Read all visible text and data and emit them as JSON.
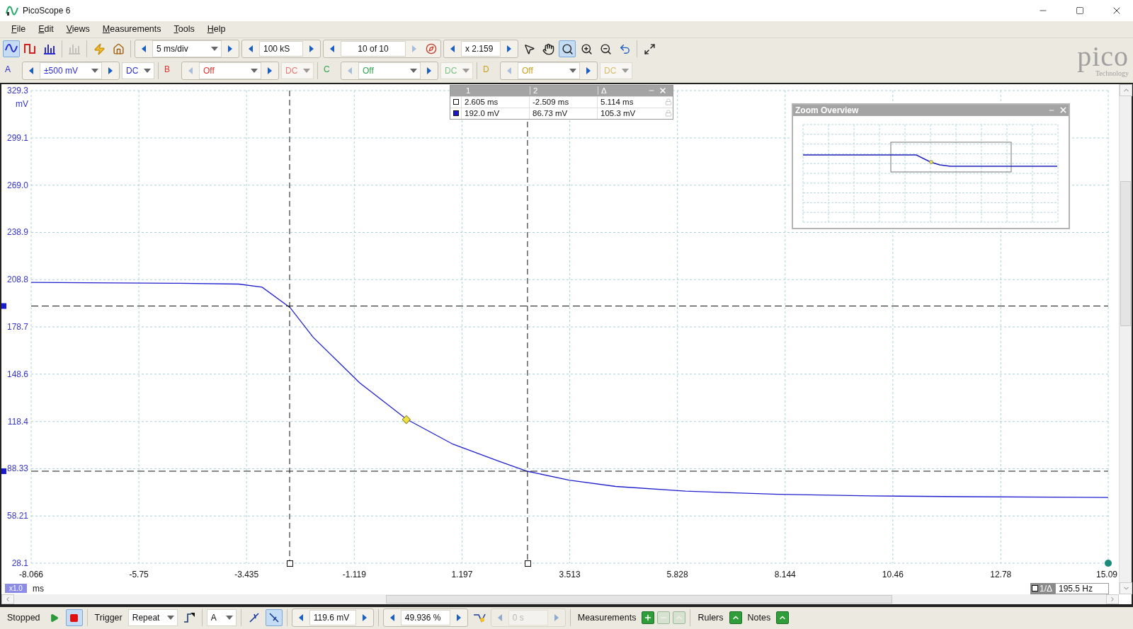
{
  "window": {
    "title": "PicoScope 6"
  },
  "menu": [
    "File",
    "Edit",
    "Views",
    "Measurements",
    "Tools",
    "Help"
  ],
  "toolbar": {
    "modes": [
      {
        "kind": "scope",
        "selected": true,
        "disabled": false
      },
      {
        "kind": "persistence",
        "selected": false,
        "disabled": false
      },
      {
        "kind": "spectrum",
        "selected": false,
        "disabled": false
      },
      {
        "kind": "xy",
        "selected": false,
        "disabled": true
      }
    ],
    "timebase": "5 ms/div",
    "samples": "100 kS",
    "buffer": "10 of 10",
    "zoom": "x 2.159",
    "tools": [
      {
        "kind": "pointer",
        "selected": false
      },
      {
        "kind": "hand",
        "selected": false
      },
      {
        "kind": "zoom-area",
        "selected": true
      },
      {
        "kind": "zoom-in",
        "selected": false
      },
      {
        "kind": "zoom-out",
        "selected": false
      },
      {
        "kind": "undo",
        "selected": false
      },
      {
        "kind": "zoom-fit",
        "selected": false
      }
    ]
  },
  "logo": {
    "name": "pico",
    "tagline": "Technology"
  },
  "channels": [
    {
      "label": "A",
      "color": "#2b2bd6",
      "range": "±500 mV",
      "coupling": "DC",
      "enabled": true
    },
    {
      "label": "B",
      "color": "#e03030",
      "range": "Off",
      "coupling": "DC",
      "enabled": false
    },
    {
      "label": "C",
      "color": "#2ea84a",
      "range": "Off",
      "coupling": "DC",
      "enabled": false
    },
    {
      "label": "D",
      "color": "#c8a020",
      "range": "Off",
      "coupling": "DC",
      "enabled": false
    }
  ],
  "rulers_table": {
    "columns": [
      "1",
      "2",
      "Δ"
    ],
    "rows": [
      {
        "kind": "time",
        "values": [
          "2.605 ms",
          "-2.509 ms",
          "5.114 ms"
        ]
      },
      {
        "kind": "signal",
        "values": [
          "192.0 mV",
          "86.73 mV",
          "105.3 mV"
        ]
      }
    ]
  },
  "zoom_overview": {
    "title": "Zoom Overview"
  },
  "scope": {
    "x_scale": "x1.0",
    "frequency_label": "1/Δ",
    "frequency": "195.5 Hz",
    "chart_data": {
      "type": "line",
      "xlabel": "ms",
      "ylabel": "mV",
      "xlim": [
        -8.066,
        15.09
      ],
      "ylim": [
        28.1,
        329.3
      ],
      "xticks": [
        {
          "value": -8.066,
          "label": "-8.066"
        },
        {
          "value": -5.75,
          "label": "-5.75"
        },
        {
          "value": -3.435,
          "label": "-3.435"
        },
        {
          "value": -1.119,
          "label": "-1.119"
        },
        {
          "value": 1.197,
          "label": "1.197"
        },
        {
          "value": 3.513,
          "label": "3.513"
        },
        {
          "value": 5.828,
          "label": "5.828"
        },
        {
          "value": 8.144,
          "label": "8.144"
        },
        {
          "value": 10.46,
          "label": "10.46"
        },
        {
          "value": 12.78,
          "label": "12.78"
        },
        {
          "value": 15.09,
          "label": "15.09"
        }
      ],
      "yticks": [
        {
          "value": 329.3,
          "label": "329.3"
        },
        {
          "value": 299.1,
          "label": "299.1"
        },
        {
          "value": 269.0,
          "label": "269.0"
        },
        {
          "value": 238.9,
          "label": "238.9"
        },
        {
          "value": 208.8,
          "label": "208.8"
        },
        {
          "value": 178.7,
          "label": "178.7"
        },
        {
          "value": 148.6,
          "label": "148.6"
        },
        {
          "value": 118.4,
          "label": "118.4"
        },
        {
          "value": 88.33,
          "label": "88.33"
        },
        {
          "value": 58.21,
          "label": "58.21"
        },
        {
          "value": 28.1,
          "label": "28.1"
        }
      ],
      "x": [
        -8.066,
        -5,
        -3.6,
        -3.1,
        -2.5,
        -2,
        -1,
        0,
        1,
        2,
        2.6,
        3.5,
        4.5,
        6,
        8,
        10,
        12,
        15.09
      ],
      "series": [
        {
          "color": "#2020d0",
          "values": [
            207,
            206.5,
            206,
            204,
            191,
            172,
            143,
            120,
            104,
            93,
            86.7,
            81,
            77,
            74,
            72,
            71,
            70.5,
            70
          ]
        }
      ],
      "grid": true,
      "ref_lines": [
        {
          "axis": "x",
          "value": -2.509
        },
        {
          "axis": "x",
          "value": 2.605
        },
        {
          "axis": "y",
          "value": 192.0
        },
        {
          "axis": "y",
          "value": 86.73
        }
      ]
    }
  },
  "status_bar": {
    "state": "Stopped",
    "running": false,
    "trigger_label": "Trigger",
    "trigger_mode": "Repeat",
    "trigger_source": "A",
    "edges": [
      {
        "kind": "rising",
        "selected": false
      },
      {
        "kind": "falling",
        "selected": true
      }
    ],
    "threshold": "119.6 mV",
    "pre_trigger": "49.936 %",
    "delay": "0 s",
    "delay_enabled": false,
    "measurements_label": "Measurements",
    "measurement_buttons": [
      {
        "kind": "add",
        "disabled": false
      },
      {
        "kind": "remove",
        "disabled": true
      },
      {
        "kind": "edit",
        "disabled": true
      }
    ],
    "rulers_label": "Rulers",
    "notes_label": "Notes"
  }
}
